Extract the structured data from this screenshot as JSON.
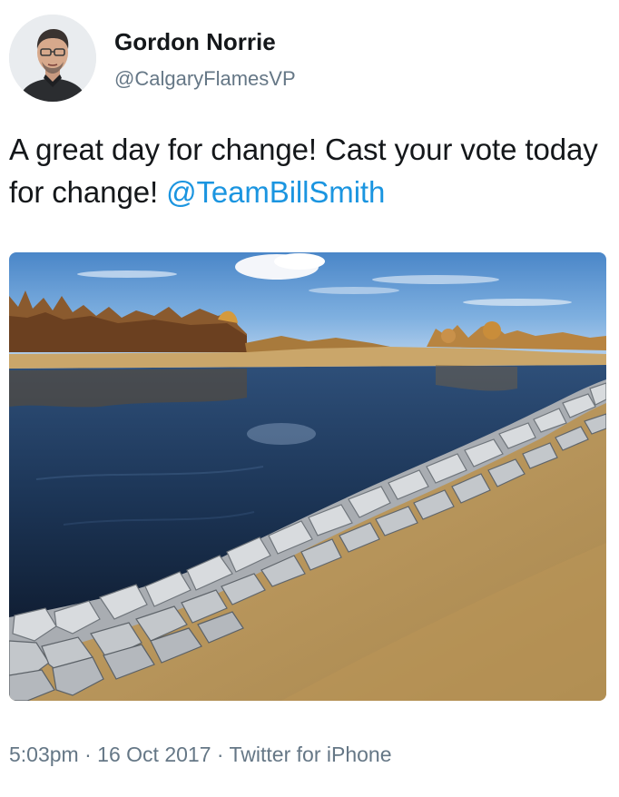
{
  "author": {
    "name": "Gordon Norrie",
    "handle": "@CalgaryFlamesVP",
    "avatar_icon": "person-portrait-icon"
  },
  "tweet": {
    "text_before": "A great day for change! Cast your vote today for change! ",
    "mention": "@TeamBillSmith",
    "mention_color": "#1b95e0"
  },
  "media": {
    "icon": "river-landscape-photo"
  },
  "meta": {
    "time": "5:03pm",
    "separator": " · ",
    "date": "16 Oct 2017",
    "source": "Twitter for iPhone"
  },
  "colors": {
    "text": "#14171a",
    "secondary": "#657786"
  }
}
